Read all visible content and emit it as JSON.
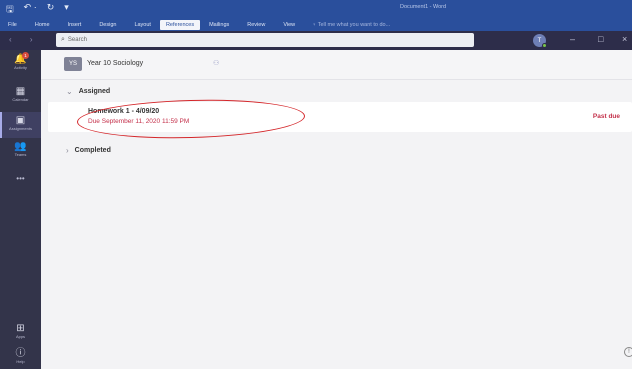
{
  "word": {
    "quick_access": [
      "🖫",
      "↶ ·",
      "↻",
      "▾"
    ],
    "title": "Document1 - Word",
    "tabs": [
      "File",
      "Home",
      "Insert",
      "Design",
      "Layout",
      "References",
      "Mailings",
      "Review",
      "View"
    ],
    "active_tab": "References",
    "tell_me": "♀ Tell me what you want to do..."
  },
  "teams": {
    "nav_arrows": "‹ ›",
    "search_placeholder": "Search",
    "avatar_initial": "T",
    "window_controls": [
      "–",
      "□",
      "×"
    ]
  },
  "rail": [
    {
      "label": "Activity",
      "icon": "bell-icon",
      "glyph": "🔔",
      "badge": "1"
    },
    {
      "label": "Calendar",
      "icon": "calendar-icon",
      "glyph": "▦"
    },
    {
      "label": "Assignments",
      "icon": "assignments-icon",
      "glyph": "▣",
      "active": true
    },
    {
      "label": "Teams",
      "icon": "teams-icon",
      "glyph": "👥"
    },
    {
      "label": "•••",
      "icon": "more-icon",
      "glyph": ""
    },
    {
      "label": "Apps",
      "icon": "apps-icon",
      "glyph": "⊞"
    },
    {
      "label": "Help",
      "icon": "help-icon",
      "glyph": "ⓘ"
    }
  ],
  "team": {
    "initials": "YS",
    "name": "Year 10 Sociology"
  },
  "sections": {
    "assigned": "Assigned",
    "completed": "Completed"
  },
  "assignment": {
    "title": "Homework 1 - 4/09/20",
    "due": "Due September 11, 2020 11:59 PM",
    "status": "Past due"
  },
  "colors": {
    "accent": "#c4314b",
    "word_blue": "#2a4f9c",
    "rail": "#33344a",
    "annotation": "#d4262a"
  }
}
